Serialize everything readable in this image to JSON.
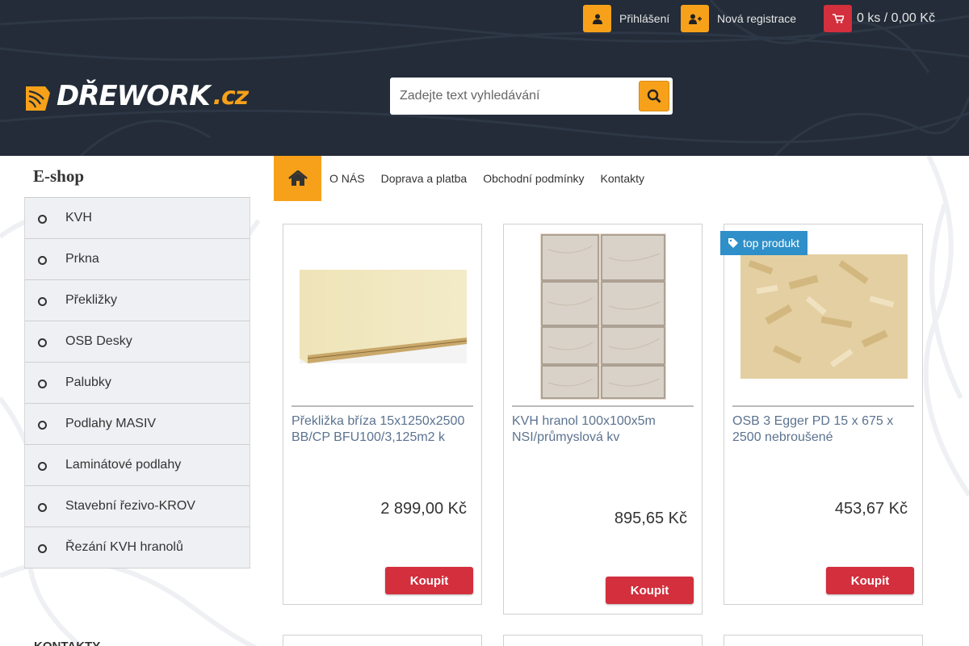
{
  "header": {
    "login_label": "Přihlášení",
    "register_label": "Nová registrace",
    "cart_label": "0 ks / 0,00 Kč",
    "logo_text": "DŘEWORK",
    "logo_tld": ".cz"
  },
  "search": {
    "placeholder": "Zadejte text vyhledávání"
  },
  "icons": {
    "login": "user-icon",
    "register": "user-plus-icon",
    "cart": "cart-icon",
    "search": "search-icon",
    "home": "home-icon",
    "tag": "tag-icon"
  },
  "colors": {
    "accent": "#f7a11a",
    "buy": "#d32f3d",
    "badge": "#2f8fc9",
    "header_bg": "#232c38",
    "product_link": "#5b7390"
  },
  "sidebar": {
    "title": "E-shop",
    "items": [
      {
        "label": "KVH"
      },
      {
        "label": "Prkna"
      },
      {
        "label": "Překližky"
      },
      {
        "label": "OSB Desky"
      },
      {
        "label": "Palubky"
      },
      {
        "label": "Podlahy MASIV"
      },
      {
        "label": "Laminátové podlahy"
      },
      {
        "label": "Stavební řezivo-KROV"
      },
      {
        "label": "Řezání KVH hranolů"
      }
    ],
    "contacts_heading": "KONTAKTY"
  },
  "nav": {
    "items": [
      {
        "label": "O NÁS"
      },
      {
        "label": "Doprava a platba"
      },
      {
        "label": "Obchodní podmínky"
      },
      {
        "label": "Kontakty"
      }
    ]
  },
  "products": [
    {
      "name": "Překližka bříza 15x1250x2500 BB/CP BFU100/3,125m2 k",
      "price": "2 899,00 Kč",
      "buy_label": "Koupit",
      "badge": ""
    },
    {
      "name": "KVH hranol 100x100x5m NSI/průmyslová kv",
      "price": "895,65 Kč",
      "buy_label": "Koupit",
      "badge": ""
    },
    {
      "name": "OSB 3 Egger PD 15 x 675 x 2500 nebroušené",
      "price": "453,67 Kč",
      "buy_label": "Koupit",
      "badge": "top produkt"
    }
  ]
}
